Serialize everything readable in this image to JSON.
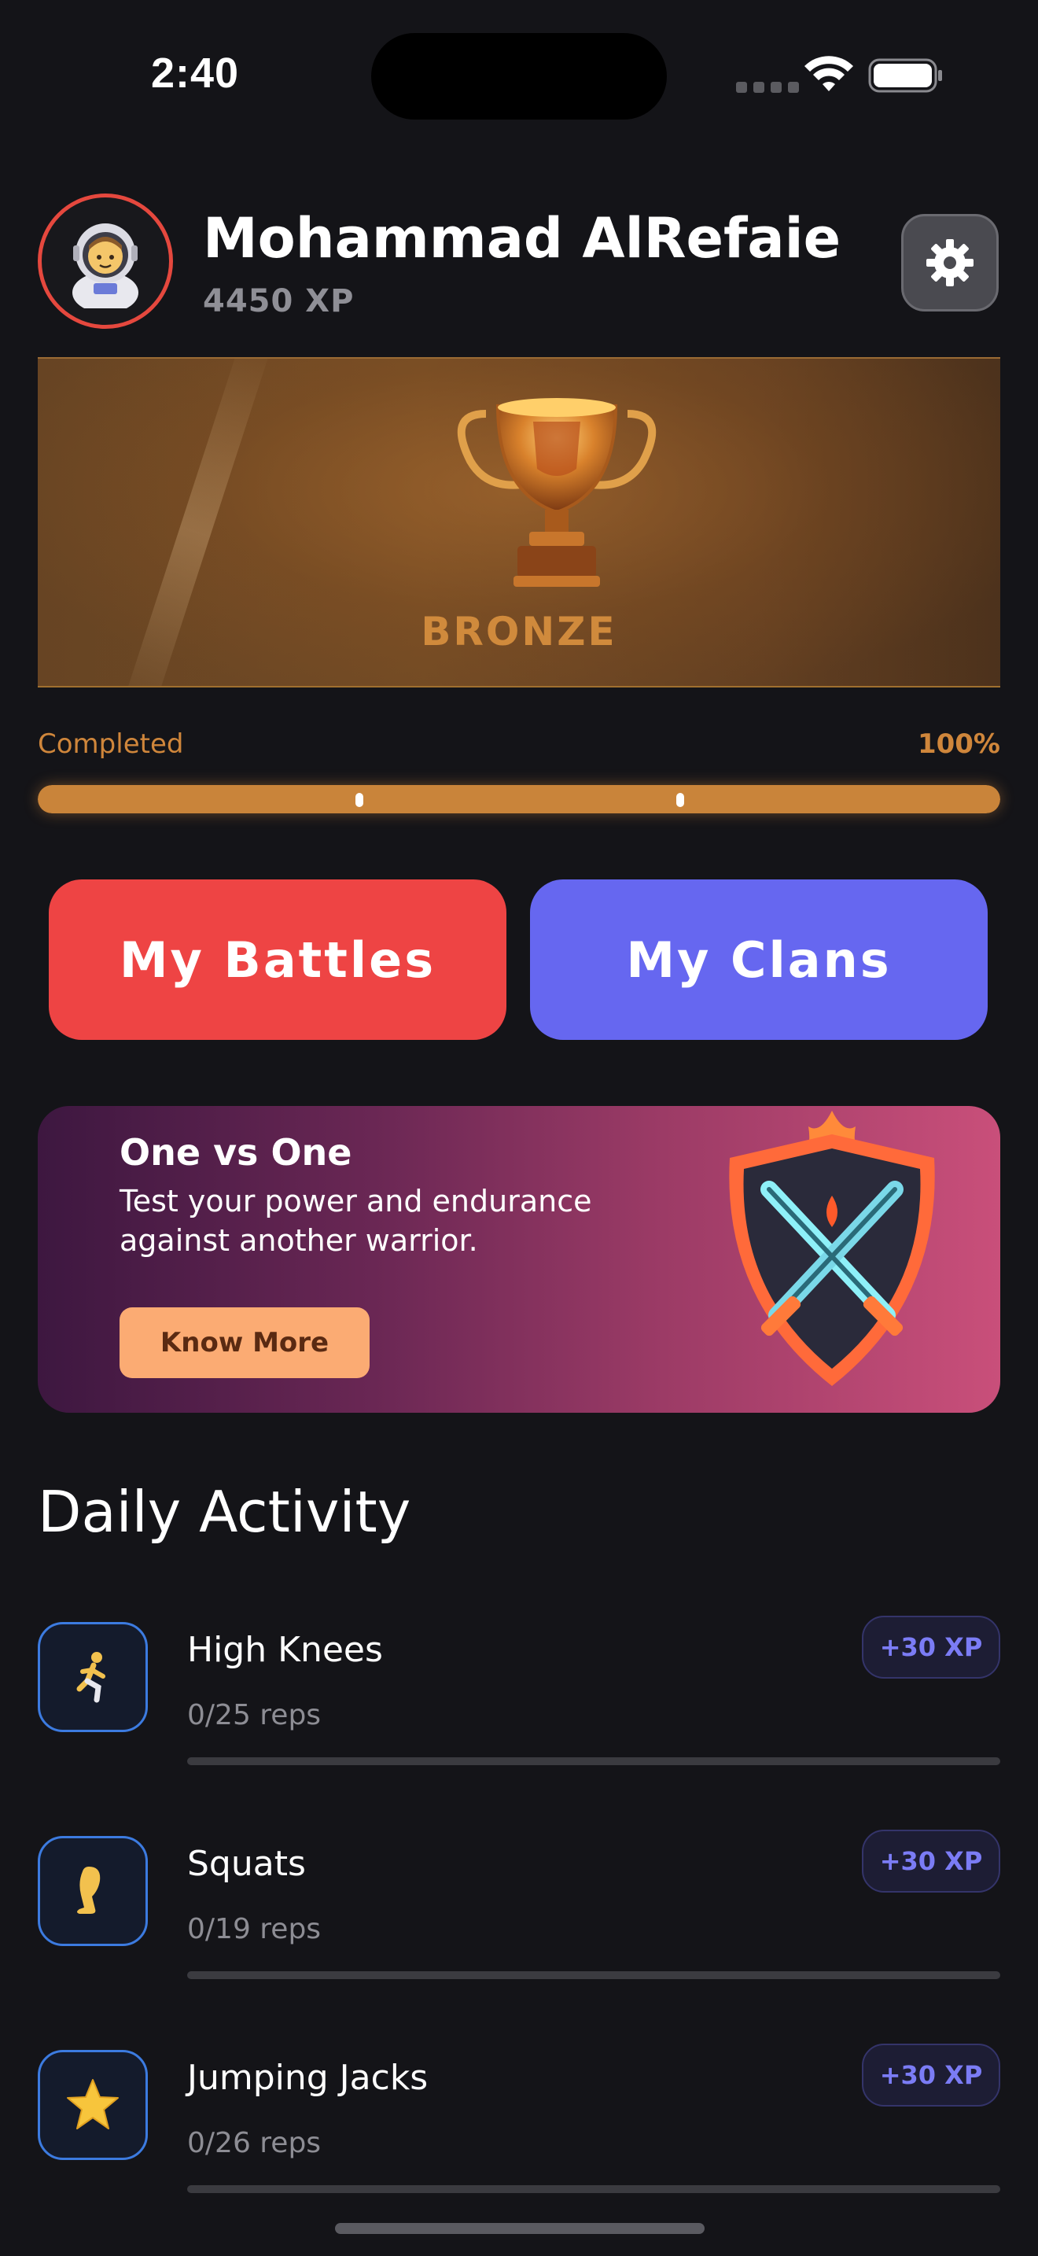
{
  "status_bar": {
    "time": "2:40"
  },
  "profile": {
    "name": "Mohammad AlRefaie",
    "xp": "4450 XP",
    "avatar_icon": "astronaut-emoji"
  },
  "rank": {
    "label": "BRONZE",
    "progress_label": "Completed",
    "progress_value": "100%",
    "progress_fraction": 1.0
  },
  "actions": {
    "battles_label": "My Battles",
    "clans_label": "My Clans"
  },
  "promo": {
    "title": "One vs One",
    "text": "Test your power and endurance against another warrior.",
    "button_label": "Know More"
  },
  "daily_activity": {
    "title": "Daily Activity",
    "items": [
      {
        "name": "High Knees",
        "reps": "0/25 reps",
        "xp": "+30 XP",
        "icon": "running-person-icon",
        "progress": 0
      },
      {
        "name": "Squats",
        "reps": "0/19 reps",
        "xp": "+30 XP",
        "icon": "leg-icon",
        "progress": 0
      },
      {
        "name": "Jumping Jacks",
        "reps": "0/26 reps",
        "xp": "+30 XP",
        "icon": "star-icon",
        "progress": 0
      }
    ]
  },
  "colors": {
    "background": "#141418",
    "accent_red": "#ee4444",
    "accent_indigo": "#6667f0",
    "bronze": "#cf863b"
  }
}
